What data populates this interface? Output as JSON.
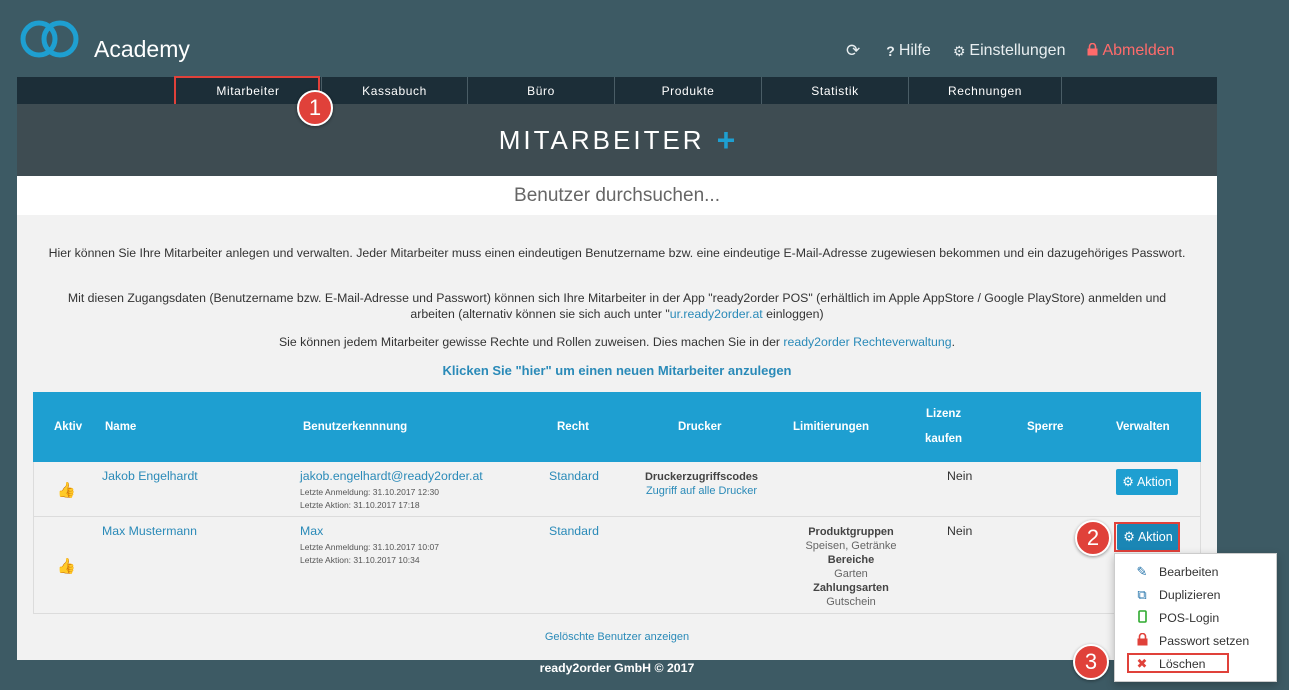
{
  "header": {
    "brand": "Academy",
    "refresh_icon": "refresh-icon",
    "help_label": "Hilfe",
    "settings_label": "Einstellungen",
    "logout_label": "Abmelden"
  },
  "tabs": [
    "Mitarbeiter",
    "Kassabuch",
    "Büro",
    "Produkte",
    "Statistik",
    "Rechnungen"
  ],
  "page": {
    "title": "MITARBEITER",
    "add_symbol": "+",
    "search_placeholder": "Benutzer durchsuchen..."
  },
  "intro": {
    "p1": "Hier können Sie Ihre Mitarbeiter anlegen und verwalten. Jeder Mitarbeiter muss einen eindeutigen Benutzername bzw. eine eindeutige E-Mail-Adresse zugewiesen bekommen und ein dazugehöriges Passwort.",
    "p2_a": "Mit diesen Zugangsdaten (Benutzername bzw. E-Mail-Adresse und Passwort) können sich Ihre Mitarbeiter in der App \"ready2order POS\" (erhältlich im Apple AppStore / Google PlayStore) anmelden und arbeiten (alternativ können sie sich auch unter \"",
    "p2_link": "ur.ready2order.at",
    "p2_b": " einloggen)",
    "p3_a": "Sie können jedem Mitarbeiter gewisse Rechte und Rollen zuweisen. Dies machen Sie in der ",
    "p3_link": "ready2order Rechteverwaltung",
    "p3_b": ".",
    "create_link": "Klicken Sie \"hier\" um einen neuen Mitarbeiter anzulegen"
  },
  "table": {
    "headers": {
      "aktiv": "Aktiv",
      "name": "Name",
      "benutzerkennung": "Benutzerkennnung",
      "recht": "Recht",
      "drucker": "Drucker",
      "limitierungen": "Limitierungen",
      "lizenz_1": "Lizenz",
      "lizenz_2": "kaufen",
      "sperre": "Sperre",
      "verwalten": "Verwalten"
    },
    "rows": [
      {
        "name": "Jakob Engelhardt",
        "login": "jakob.engelhardt@ready2order.at",
        "last_login": "Letzte Anmeldung: 31.10.2017 12:30",
        "last_action": "Letzte Aktion: 31.10.2017 17:18",
        "recht": "Standard",
        "drucker_title": "Druckerzugriffscodes",
        "drucker_link": "Zugriff auf alle Drucker",
        "lizenz": "Nein",
        "action_label": "Aktion"
      },
      {
        "name": "Max Mustermann",
        "login": "Max",
        "last_login": "Letzte Anmeldung: 31.10.2017 10:07",
        "last_action": "Letzte Aktion: 31.10.2017 10:34",
        "recht": "Standard",
        "lim_1_title": "Produktgruppen",
        "lim_1_value": "Speisen, Getränke",
        "lim_2_title": "Bereiche",
        "lim_2_value": "Garten",
        "lim_3_title": "Zahlungsarten",
        "lim_3_value": "Gutschein",
        "lizenz": "Nein",
        "action_label": "Aktion"
      }
    ],
    "deleted_link": "Gelöschte Benutzer anzeigen"
  },
  "dropdown": {
    "items": [
      {
        "label": "Bearbeiten",
        "icon": "pencil-icon"
      },
      {
        "label": "Duplizieren",
        "icon": "copy-icon"
      },
      {
        "label": "POS-Login",
        "icon": "mobile-icon"
      },
      {
        "label": "Passwort setzen",
        "icon": "lock-icon"
      },
      {
        "label": "Löschen",
        "icon": "delete-icon"
      }
    ]
  },
  "markers": [
    "1",
    "2",
    "3"
  ],
  "footer": "ready2order GmbH © 2017",
  "colors": {
    "background": "#3d5a64",
    "accent": "#1e9fd1",
    "highlight": "#e0413a",
    "tabbar": "#1c2e38"
  }
}
